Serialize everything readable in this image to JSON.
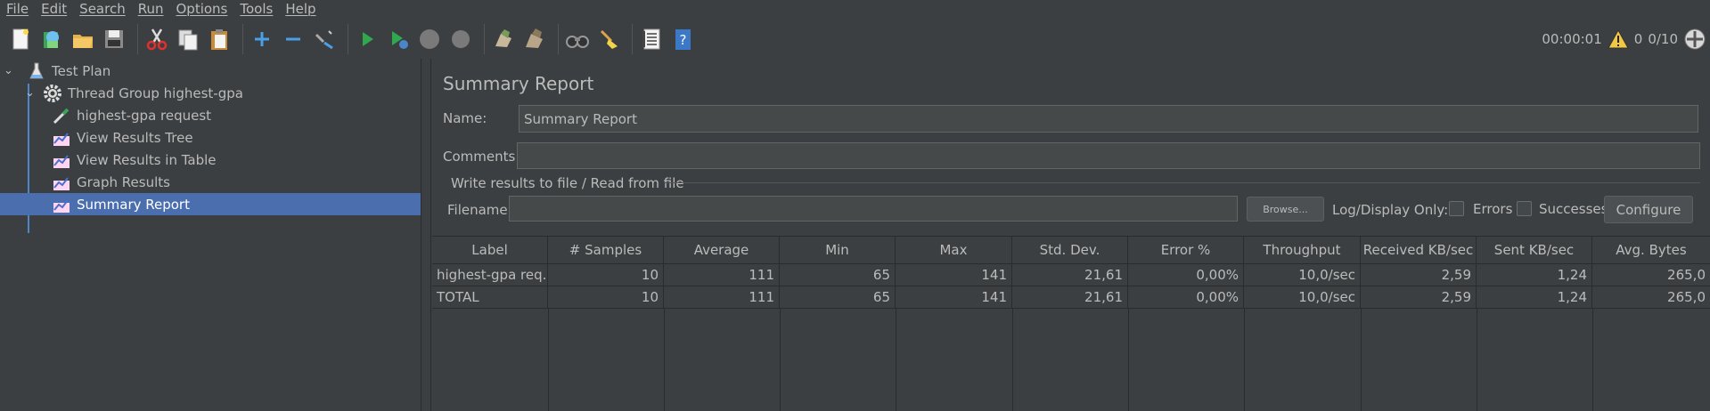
{
  "menu": [
    "File",
    "Edit",
    "Search",
    "Run",
    "Options",
    "Tools",
    "Help"
  ],
  "status": {
    "elapsed": "00:00:01",
    "warnings": "0",
    "threads": "0/10"
  },
  "toolbar_icons": [
    "new-icon",
    "templates-icon",
    "open-icon",
    "save-icon",
    "cut-icon",
    "copy-icon",
    "paste-icon",
    "expand-icon",
    "collapse-icon",
    "toggle-icon",
    "start-icon",
    "start-no-pause-icon",
    "stop-icon",
    "shutdown-icon",
    "clear-icon",
    "clear-all-icon",
    "search-icon",
    "reset-search-icon",
    "function-helper-icon",
    "help-icon"
  ],
  "tree": [
    {
      "label": "Test Plan",
      "icon": "flask-icon"
    },
    {
      "label": "Thread Group highest-gpa",
      "icon": "gear-icon"
    },
    {
      "label": "highest-gpa request",
      "icon": "pipette-icon"
    },
    {
      "label": "View Results Tree",
      "icon": "listener-icon"
    },
    {
      "label": "View Results in Table",
      "icon": "listener-icon"
    },
    {
      "label": "Graph Results",
      "icon": "listener-icon"
    },
    {
      "label": "Summary Report",
      "icon": "listener-icon"
    }
  ],
  "panel": {
    "title": "Summary Report",
    "name_label": "Name:",
    "name_value": "Summary Report",
    "comments_label": "Comments:",
    "comments_value": "",
    "file_group": "Write results to file / Read from file",
    "filename_label": "Filename",
    "filename_value": "",
    "browse": "Browse...",
    "log_display": "Log/Display Only:",
    "errors": "Errors",
    "successes": "Successes",
    "configure": "Configure"
  },
  "table": {
    "headers": [
      "Label",
      "# Samples",
      "Average",
      "Min",
      "Max",
      "Std. Dev.",
      "Error %",
      "Throughput",
      "Received KB/sec",
      "Sent KB/sec",
      "Avg. Bytes"
    ],
    "rows": [
      [
        "highest-gpa req...",
        "10",
        "111",
        "65",
        "141",
        "21,61",
        "0,00%",
        "10,0/sec",
        "2,59",
        "1,24",
        "265,0"
      ],
      [
        "TOTAL",
        "10",
        "111",
        "65",
        "141",
        "21,61",
        "0,00%",
        "10,0/sec",
        "2,59",
        "1,24",
        "265,0"
      ]
    ]
  }
}
